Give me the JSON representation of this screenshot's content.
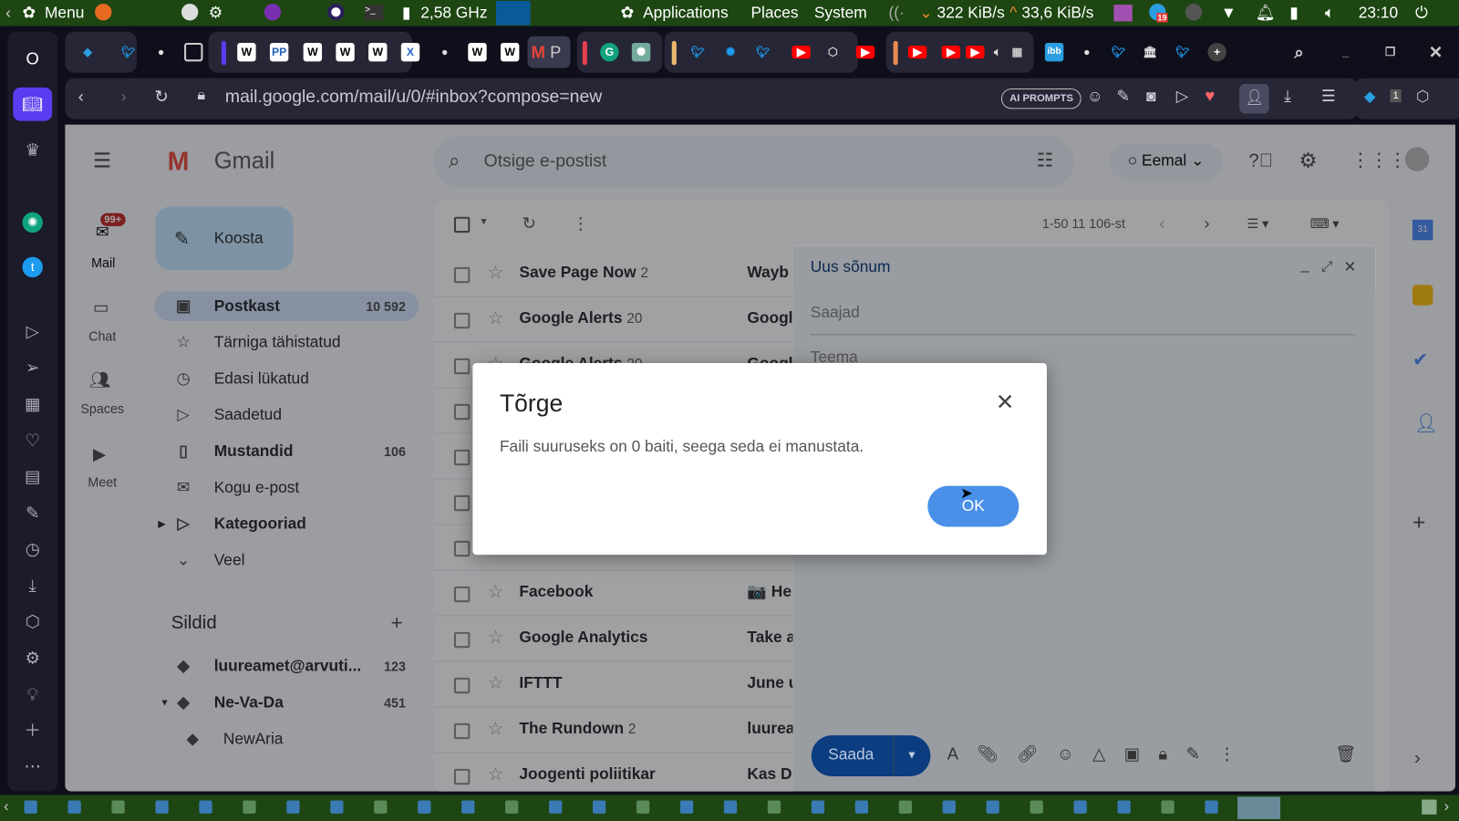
{
  "panel": {
    "menu": "Menu",
    "cpu": "2,58 GHz",
    "applications": "Applications",
    "places": "Places",
    "system": "System",
    "net_down": "322 KiB/s",
    "net_up": "33,6 KiB/s",
    "clock": "23:10",
    "telegram_badge": "19"
  },
  "browser": {
    "url": "mail.google.com/mail/u/0/#inbox?compose=new",
    "ai_prompts": "AI PROMPTS",
    "tab_gmail_label": "P",
    "ext_badge": "1"
  },
  "gmail": {
    "logo": "Gmail",
    "search_placeholder": "Otsige e-postist",
    "status": "Eemal",
    "rail": [
      {
        "label": "Mail",
        "badge": "99+"
      },
      {
        "label": "Chat"
      },
      {
        "label": "Spaces"
      },
      {
        "label": "Meet"
      }
    ],
    "compose_label": "Koosta",
    "nav": [
      {
        "label": "Postkast",
        "count": "10 592"
      },
      {
        "label": "Tärniga tähistatud",
        "count": ""
      },
      {
        "label": "Edasi lükatud",
        "count": ""
      },
      {
        "label": "Saadetud",
        "count": ""
      },
      {
        "label": "Mustandid",
        "count": "106"
      },
      {
        "label": "Kogu e-post",
        "count": ""
      },
      {
        "label": "Kategooriad",
        "count": ""
      },
      {
        "label": "Veel",
        "count": ""
      }
    ],
    "labels_title": "Sildid",
    "labels": [
      {
        "label": "luureamet@arvuti...",
        "count": "123"
      },
      {
        "label": "Ne-Va-Da",
        "count": "451"
      },
      {
        "label": "NewAria",
        "count": ""
      }
    ],
    "pagination": "1-50 11 106-st",
    "rows": [
      {
        "from": "Save Page Now",
        "n": "2",
        "subject": "Wayb"
      },
      {
        "from": "Google Alerts",
        "n": "20",
        "subject": "Googl"
      },
      {
        "from": "Google Alerts",
        "n": "20",
        "subject": "Googl"
      },
      {
        "from": "",
        "n": "",
        "subject": ""
      },
      {
        "from": "",
        "n": "",
        "subject": ""
      },
      {
        "from": "",
        "n": "",
        "subject": ""
      },
      {
        "from": "",
        "n": "",
        "subject": ""
      },
      {
        "from": "Facebook",
        "n": "",
        "subject": "📷 He"
      },
      {
        "from": "Google Analytics",
        "n": "",
        "subject": "Take a"
      },
      {
        "from": "IFTTT",
        "n": "",
        "subject": "June u"
      },
      {
        "from": "The Rundown",
        "n": "2",
        "subject": "luurea"
      },
      {
        "from": "Joogenti poliitikar",
        "n": "",
        "subject": "Kas D"
      }
    ],
    "compose": {
      "title": "Uus sõnum",
      "to_placeholder": "Saajad",
      "subject_placeholder": "Teema",
      "send": "Saada"
    }
  },
  "dialog": {
    "title": "Tõrge",
    "message": "Faili suuruseks on 0 baiti, seega seda ei manustata.",
    "ok": "OK"
  }
}
